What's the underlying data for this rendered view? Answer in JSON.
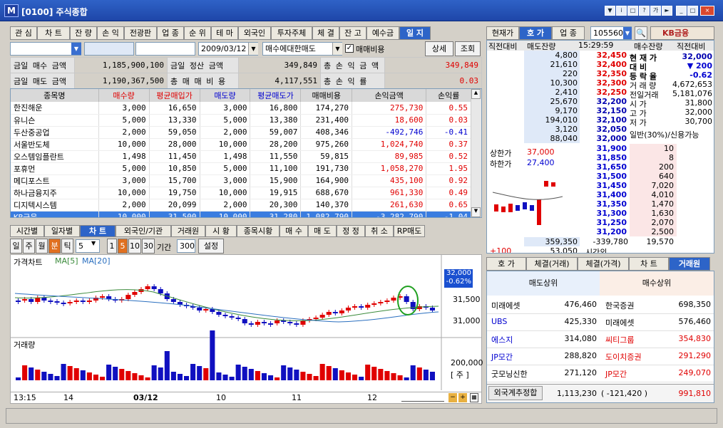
{
  "window": {
    "title": "[0100] 주식종합",
    "logo": "M"
  },
  "left_tabs": [
    "관 심",
    "차 트",
    "잔 량",
    "손 익",
    "전광판",
    "업 종",
    "순 위",
    "테 마",
    "외국인",
    "투자주체",
    "체 결",
    "잔 고",
    "예수금",
    "일 지"
  ],
  "left_tab_active": "일 지",
  "filter": {
    "date": "2009/03/12",
    "mode": "매수에대한매도",
    "checkbox_label": "매매비용",
    "detail_btn": "상세",
    "query_btn": "조회"
  },
  "summary": {
    "rows": [
      {
        "l1": "금일 매수 금액",
        "v1": "1,185,900,100",
        "l2": "금일 정산 금액",
        "v2": "349,849",
        "l3": "총 손 익 금 액",
        "v3": "349,849"
      },
      {
        "l1": "금일 매도 금액",
        "v1": "1,190,367,500",
        "l2": "총 매 매 비 용",
        "v2": "4,117,551",
        "l3": "총 손 익 률",
        "v3": "0.03"
      }
    ]
  },
  "journal": {
    "headers": [
      "종목명",
      "매수량",
      "평균매입가",
      "매도량",
      "평균매도가",
      "매매비용",
      "손익금액",
      "손익률"
    ],
    "rows": [
      [
        "한진해운",
        "3,000",
        "16,650",
        "3,000",
        "16,800",
        "174,270",
        "275,730",
        "0.55"
      ],
      [
        "유니슨",
        "5,000",
        "13,330",
        "5,000",
        "13,380",
        "231,400",
        "18,600",
        "0.03"
      ],
      [
        "두산중공업",
        "2,000",
        "59,050",
        "2,000",
        "59,007",
        "408,346",
        "-492,746",
        "-0.41"
      ],
      [
        "서울반도체",
        "10,000",
        "28,000",
        "10,000",
        "28,200",
        "975,260",
        "1,024,740",
        "0.37"
      ],
      [
        "오스템임플란트",
        "1,498",
        "11,450",
        "1,498",
        "11,550",
        "59,815",
        "89,985",
        "0.52"
      ],
      [
        "포휴먼",
        "5,000",
        "10,850",
        "5,000",
        "11,100",
        "191,730",
        "1,058,270",
        "1.95"
      ],
      [
        "메디포스트",
        "3,000",
        "15,700",
        "3,000",
        "15,900",
        "164,900",
        "435,100",
        "0.92"
      ],
      [
        "하나금융지주",
        "10,000",
        "19,750",
        "10,000",
        "19,915",
        "688,670",
        "961,330",
        "0.49"
      ],
      [
        "디지텍시스템",
        "2,000",
        "20,099",
        "2,000",
        "20,300",
        "140,370",
        "261,630",
        "0.65"
      ],
      [
        "KB금융",
        "10,000",
        "31,500",
        "10,000",
        "31,280",
        "1,082,790",
        "-3,282,790",
        "-1.04"
      ]
    ]
  },
  "chart_tabs": [
    "시간별",
    "일자별",
    "차 트",
    "외국인/기관",
    "거래원",
    "시 황",
    "종목시황",
    "매 수",
    "매 도",
    "정 정",
    "취 소",
    "RP매도"
  ],
  "chart_tab_active": "차 트",
  "chart_toolbar": {
    "periods": [
      "일",
      "주",
      "월",
      "분",
      "틱"
    ],
    "period_active": "분",
    "interval": "5",
    "nums": [
      "1",
      "5",
      "10",
      "30"
    ],
    "num_active": "5",
    "range_label": "기간",
    "range_value": "300",
    "settings": "설정"
  },
  "chart_labels": {
    "price_title": "가격차트",
    "ma5": "MA[5]",
    "ma20": "MA[20]",
    "cur_price": "32,000",
    "cur_pct": "-0.62%",
    "y1": "31,500",
    "y2": "31,000",
    "vol_title": "거래량",
    "vol_y": "200,000",
    "vol_unit": "[ 주 ]",
    "x_labels": [
      "13:15",
      "14",
      "03/12",
      "10",
      "11",
      "12"
    ]
  },
  "chart_data": {
    "type": "line",
    "title": "가격차트",
    "ylim": [
      30800,
      32050
    ],
    "series": [
      {
        "name": "MA[5]"
      },
      {
        "name": "MA[20]"
      }
    ],
    "x": [
      "13:15",
      "14",
      "03/12",
      "10",
      "11",
      "12"
    ],
    "current": 32000
  },
  "right": {
    "tabs": [
      "현재가",
      "호 가",
      "업 종"
    ],
    "tab_active": "호 가",
    "code": "105560",
    "stock_name": "KB금융",
    "header": {
      "c1": "직전대비",
      "c2": "매도잔량",
      "time": "15:29:59",
      "c3": "매수잔량",
      "c4": "직전대비"
    },
    "asks": [
      [
        "4,800",
        "32,450"
      ],
      [
        "21,610",
        "32,400"
      ],
      [
        "220",
        "32,350"
      ],
      [
        "10,300",
        "32,300"
      ],
      [
        "2,410",
        "32,250"
      ],
      [
        "25,670",
        "32,200"
      ],
      [
        "9,170",
        "32,150"
      ],
      [
        "194,010",
        "32,100"
      ],
      [
        "3,120",
        "32,050"
      ],
      [
        "88,040",
        "32,000"
      ]
    ],
    "bids": [
      [
        "31,900",
        "10"
      ],
      [
        "31,850",
        "8"
      ],
      [
        "31,650",
        "200"
      ],
      [
        "31,500",
        "640"
      ],
      [
        "31,450",
        "7,020"
      ],
      [
        "31,400",
        "4,010"
      ],
      [
        "31,350",
        "1,470"
      ],
      [
        "31,300",
        "1,630"
      ],
      [
        "31,250",
        "2,070"
      ],
      [
        "31,200",
        "2,500"
      ]
    ],
    "info": [
      [
        "현 재 가",
        "32,000"
      ],
      [
        "대 비",
        "▼ 200"
      ],
      [
        "등 락 율",
        "-0.62"
      ],
      [
        "거 래 량",
        "4,672,653"
      ],
      [
        "전일거래",
        "5,181,076"
      ],
      [
        "시 가",
        "31,800"
      ],
      [
        "고 가",
        "32,000"
      ],
      [
        "저 가",
        "30,700"
      ]
    ],
    "margin": "일반(30%)/신용가능",
    "limits": [
      [
        "상한가",
        "37,000"
      ],
      [
        "하한가",
        "27,400"
      ]
    ],
    "totals": {
      "plus": "+100",
      "ask_total": "359,350",
      "diff": "-339,780",
      "bid_total": "19,570",
      "after_hours_ask": "53,050",
      "after_label": "시간외"
    }
  },
  "bottom_tabs": [
    "호 가",
    "체결(거래)",
    "체결(가격)",
    "차 트",
    "거래원"
  ],
  "bottom_tab_active": "거래원",
  "brokers": {
    "sell_header": "매도상위",
    "buy_header": "매수상위",
    "rows": [
      [
        "미래에셋",
        "476,460",
        "한국증권",
        "698,350"
      ],
      [
        "UBS",
        "425,330",
        "미래에셋",
        "576,460"
      ],
      [
        "에스지",
        "314,080",
        "씨티그룹",
        "354,830"
      ],
      [
        "JP모간",
        "288,820",
        "도이치증권",
        "291,290"
      ],
      [
        "굿모닝신한",
        "271,120",
        "JP모간",
        "249,070"
      ]
    ],
    "foreign": {
      "label": "외국계추정합",
      "sell": "1,113,230",
      "diff": "( -121,420 )",
      "buy": "991,810"
    }
  },
  "colors": {
    "up": "#e00000",
    "down": "#0000d0",
    "active_tab": "#2d64c8"
  }
}
